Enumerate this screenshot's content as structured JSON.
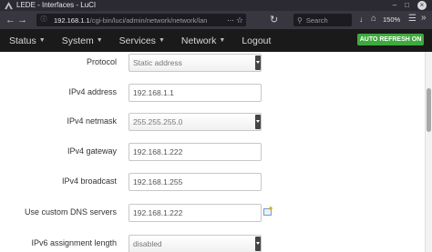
{
  "browser": {
    "tab_title": "LEDE - Interfaces - LuCI",
    "url_host": "192.168.1.1",
    "url_path": "/cgi-bin/luci/admin/network/network/lan",
    "search_placeholder": "Search",
    "zoom": "150%"
  },
  "menu": {
    "items": [
      {
        "label": "Status",
        "has_dropdown": true
      },
      {
        "label": "System",
        "has_dropdown": true
      },
      {
        "label": "Services",
        "has_dropdown": true
      },
      {
        "label": "Network",
        "has_dropdown": true
      },
      {
        "label": "Logout",
        "has_dropdown": false
      }
    ],
    "auto_refresh": "AUTO REFRESH ON",
    "auto_refresh_color": "#3daa3d"
  },
  "form": {
    "protocol": {
      "label": "Protocol",
      "value": "Static address"
    },
    "ipv4_address": {
      "label": "IPv4 address",
      "value": "192.168.1.1"
    },
    "ipv4_netmask": {
      "label": "IPv4 netmask",
      "value": "255.255.255.0"
    },
    "ipv4_gateway": {
      "label": "IPv4 gateway",
      "value": "192.168.1.222"
    },
    "ipv4_broadcast": {
      "label": "IPv4 broadcast",
      "value": "192.168.1.255"
    },
    "dns_servers": {
      "label": "Use custom DNS servers",
      "value": "192.168.1.222"
    },
    "ipv6_assignment_length": {
      "label": "IPv6 assignment length",
      "value": "disabled"
    }
  }
}
